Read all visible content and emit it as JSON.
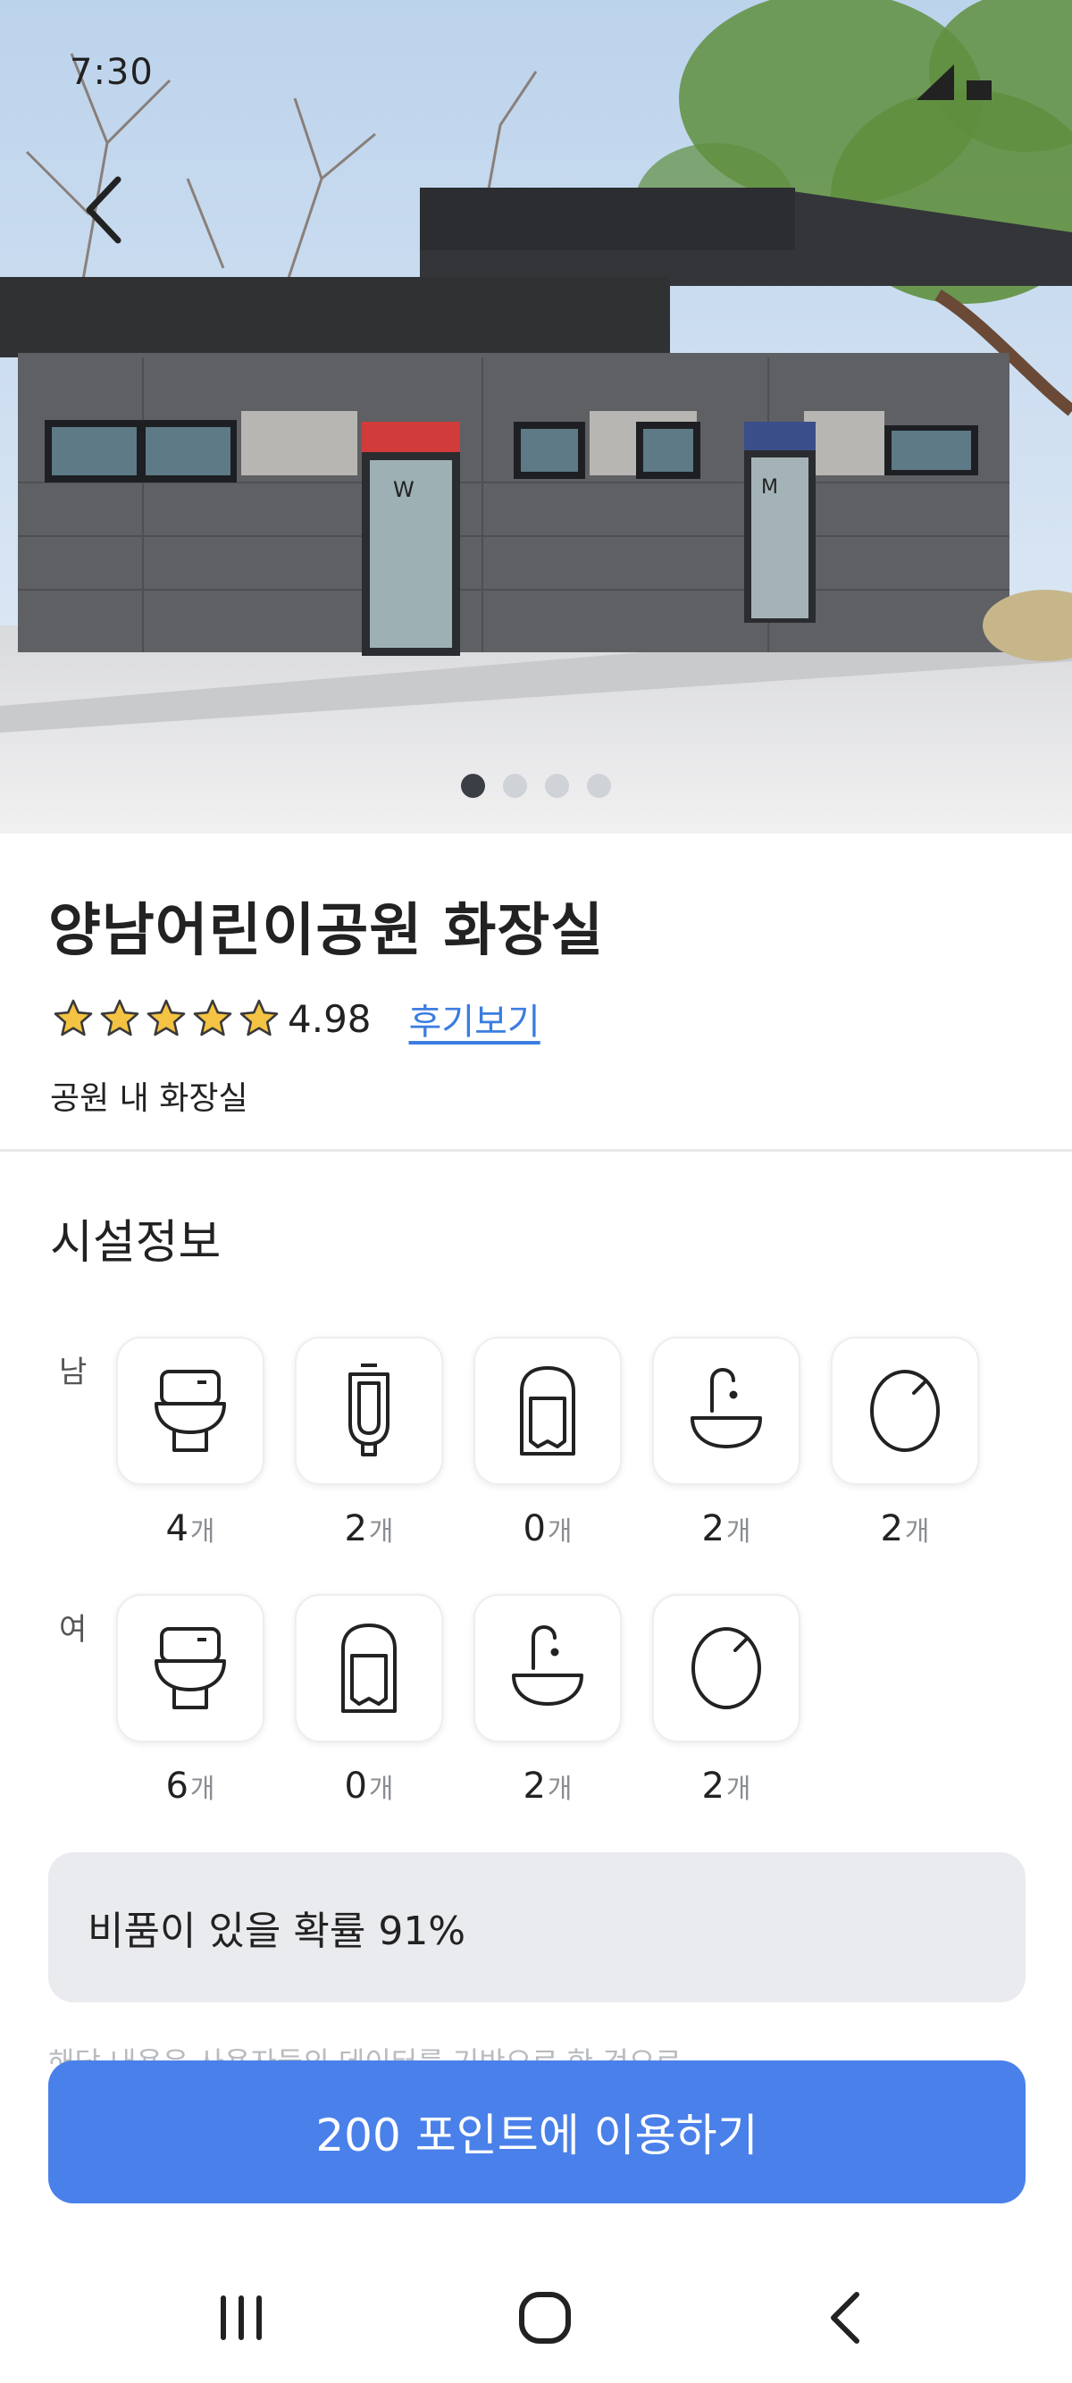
{
  "status_bar": {
    "time": "7:30"
  },
  "gallery": {
    "page_count": 4,
    "active_index": 0
  },
  "place": {
    "title": "양남어린이공원 화장실",
    "rating": "4.98",
    "stars": 5,
    "review_link": "후기보기",
    "category": "공원 내 화장실"
  },
  "facilities": {
    "section_title": "시설정보",
    "unit": "개",
    "male": {
      "label": "남",
      "items": [
        {
          "icon": "toilet-icon",
          "count": "4"
        },
        {
          "icon": "urinal-icon",
          "count": "2"
        },
        {
          "icon": "paper-towel-icon",
          "count": "0"
        },
        {
          "icon": "sink-icon",
          "count": "2"
        },
        {
          "icon": "mirror-icon",
          "count": "2"
        }
      ]
    },
    "female": {
      "label": "여",
      "items": [
        {
          "icon": "toilet-icon",
          "count": "6"
        },
        {
          "icon": "paper-towel-icon",
          "count": "0"
        },
        {
          "icon": "sink-icon",
          "count": "2"
        },
        {
          "icon": "mirror-icon",
          "count": "2"
        }
      ]
    }
  },
  "supplies_probability": "비품이 있을 확률 91%",
  "note": "해당 내용은 사용자들의 데이터를 기반으로 한 것으로",
  "cta_label": "200 포인트에 이용하기",
  "colors": {
    "accent": "#4a80ea",
    "link": "#3b7de0",
    "star": "#f5c343",
    "box": "#eaebee"
  }
}
